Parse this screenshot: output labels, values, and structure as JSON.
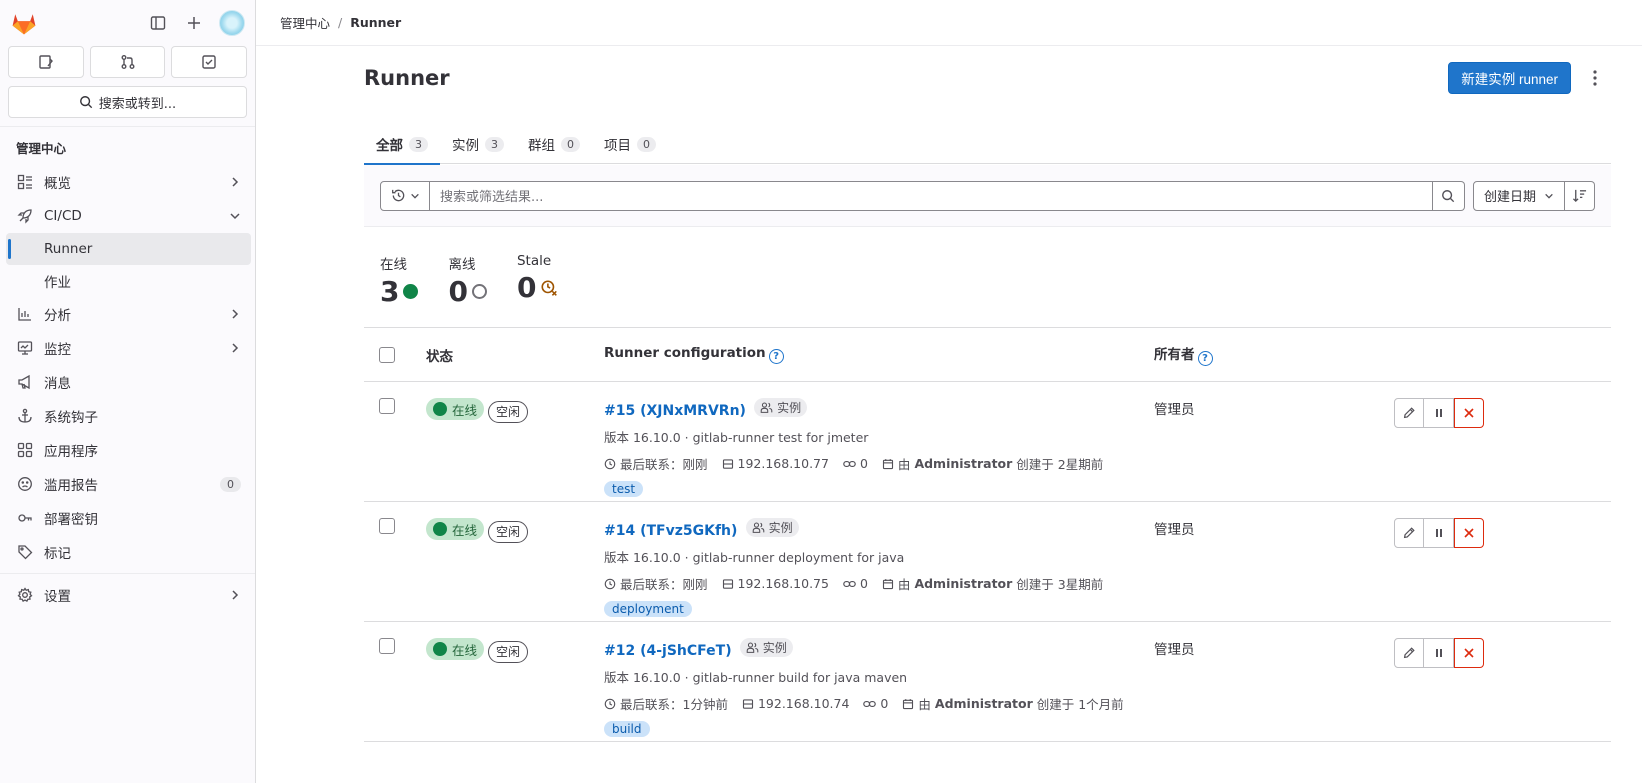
{
  "sidebar": {
    "search_label": "搜索或转到...",
    "section_title": "管理中心",
    "items": [
      {
        "label": "概览"
      },
      {
        "label": "CI/CD"
      },
      {
        "label": "Runner"
      },
      {
        "label": "作业"
      },
      {
        "label": "分析"
      },
      {
        "label": "监控"
      },
      {
        "label": "消息"
      },
      {
        "label": "系统钩子"
      },
      {
        "label": "应用程序"
      },
      {
        "label": "滥用报告",
        "count": "0"
      },
      {
        "label": "部署密钥"
      },
      {
        "label": "标记"
      },
      {
        "label": "设置"
      }
    ]
  },
  "breadcrumb": {
    "parent": "管理中心",
    "separator": "/",
    "current": "Runner"
  },
  "page": {
    "title": "Runner",
    "new_button": "新建实例 runner"
  },
  "tabs": [
    {
      "label": "全部",
      "count": "3"
    },
    {
      "label": "实例",
      "count": "3"
    },
    {
      "label": "群组",
      "count": "0"
    },
    {
      "label": "项目",
      "count": "0"
    }
  ],
  "filter": {
    "placeholder": "搜索或筛选结果...",
    "sort_label": "创建日期"
  },
  "stats": [
    {
      "label": "在线",
      "value": "3"
    },
    {
      "label": "离线",
      "value": "0"
    },
    {
      "label": "Stale",
      "value": "0"
    }
  ],
  "table": {
    "headers": {
      "status": "状态",
      "config": "Runner configuration",
      "owner": "所有者"
    },
    "rows": [
      {
        "status": "在线",
        "idle": "空闲",
        "name": "#15 (XJNxMRVRn)",
        "type": "实例",
        "version_line": "版本 16.10.0 · gitlab-runner test for jmeter",
        "last_contact": "最后联系：刚刚",
        "ip": "192.168.10.77",
        "jobs": "0",
        "created_by": "由",
        "creator": "Administrator",
        "created_at": "创建于 2星期前",
        "tag": "test",
        "owner": "管理员"
      },
      {
        "status": "在线",
        "idle": "空闲",
        "name": "#14 (TFvz5GKfh)",
        "type": "实例",
        "version_line": "版本 16.10.0 · gitlab-runner deployment for java",
        "last_contact": "最后联系：刚刚",
        "ip": "192.168.10.75",
        "jobs": "0",
        "created_by": "由",
        "creator": "Administrator",
        "created_at": "创建于 3星期前",
        "tag": "deployment",
        "owner": "管理员"
      },
      {
        "status": "在线",
        "idle": "空闲",
        "name": "#12 (4-jShCFeT)",
        "type": "实例",
        "version_line": "版本 16.10.0 · gitlab-runner build for java maven",
        "last_contact": "最后联系：1分钟前",
        "ip": "192.168.10.74",
        "jobs": "0",
        "created_by": "由",
        "creator": "Administrator",
        "created_at": "创建于 1个月前",
        "tag": "build",
        "owner": "管理员"
      }
    ]
  },
  "colors": {
    "primary": "#1f75cb",
    "online": "#108548",
    "danger": "#dd2b0e",
    "logo": "#e24329"
  }
}
